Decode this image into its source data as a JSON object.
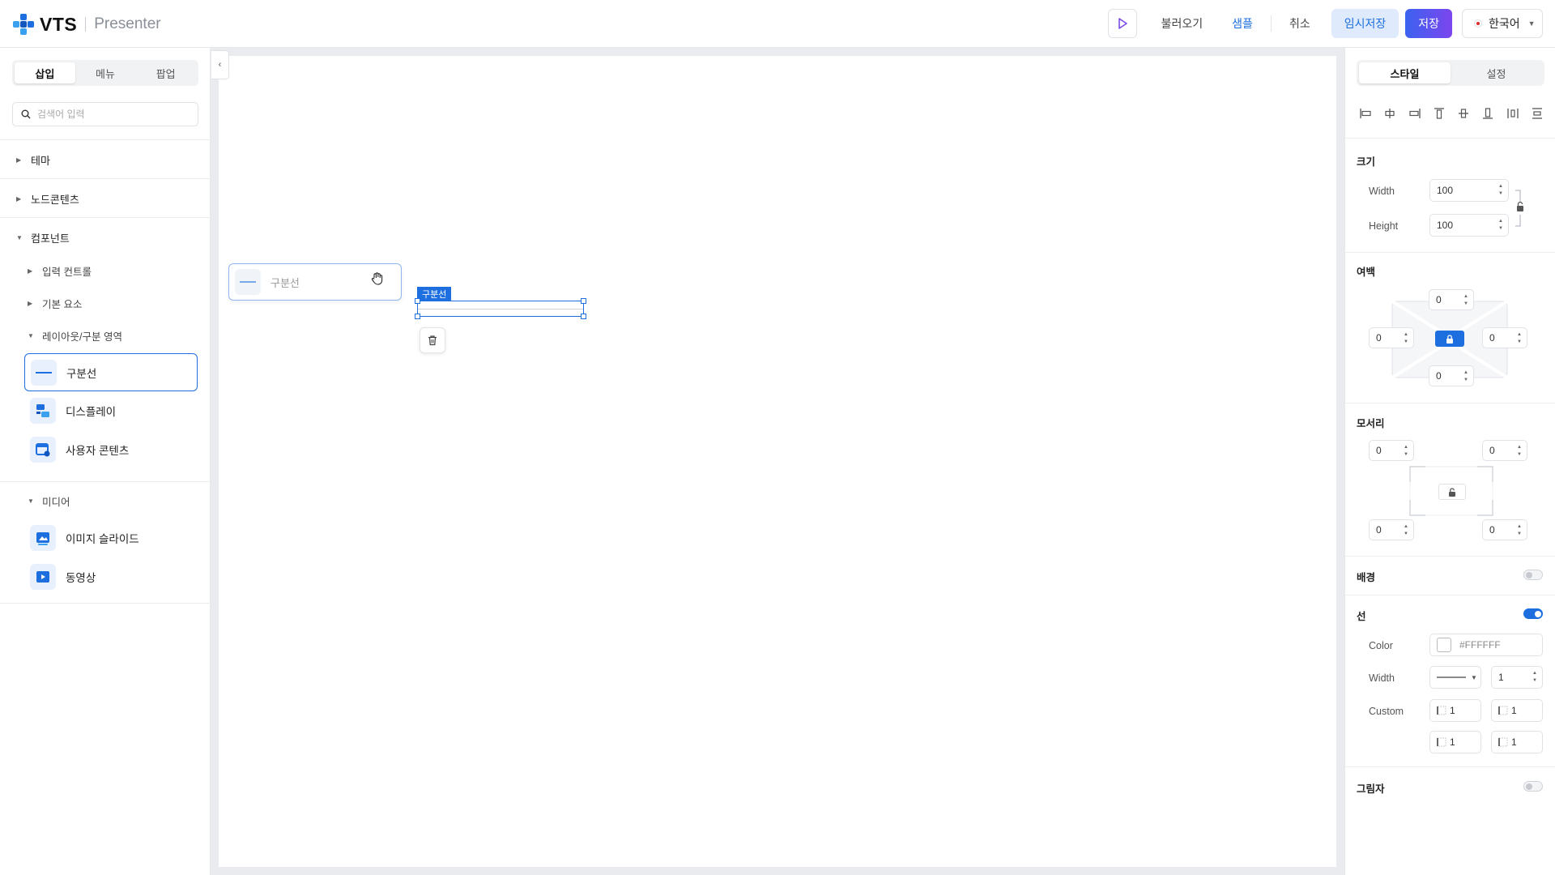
{
  "header": {
    "logo_text": "VTS",
    "app_name": "Presenter",
    "buttons": {
      "load": "불러오기",
      "sample": "샘플",
      "cancel": "취소",
      "temp_save": "임시저장",
      "save": "저장"
    },
    "language": "한국어"
  },
  "sidebar": {
    "tabs": [
      "삽입",
      "메뉴",
      "팝업"
    ],
    "search_placeholder": "검색어 입력",
    "sections": {
      "theme": "테마",
      "node_contents": "노드콘텐츠",
      "components": "컴포넌트",
      "input_control": "입력 컨트롤",
      "basic_elements": "기본 요소",
      "layout_divider": "레이아웃/구분 영역",
      "media": "미디어"
    },
    "layout_items": [
      "구분선",
      "디스플레이",
      "사용자 콘텐츠"
    ],
    "media_items": [
      "이미지 슬라이드",
      "동영상"
    ]
  },
  "canvas": {
    "drag_chip_label": "구분선",
    "selection_label": "구분선"
  },
  "right_panel": {
    "tabs": [
      "스타일",
      "설정"
    ],
    "size": {
      "title": "크기",
      "width_label": "Width",
      "width": "100",
      "height_label": "Height",
      "height": "100"
    },
    "margin": {
      "title": "여백",
      "top": "0",
      "left": "0",
      "right": "0",
      "bottom": "0"
    },
    "corner": {
      "title": "모서리",
      "top_left": "0",
      "top_right": "0",
      "bottom_left": "0",
      "bottom_right": "0"
    },
    "background": {
      "title": "배경",
      "enabled": false
    },
    "line": {
      "title": "선",
      "enabled": true,
      "color_label": "Color",
      "color": "#FFFFFF",
      "width_label": "Width",
      "width": "1",
      "custom_label": "Custom",
      "custom": [
        "1",
        "1",
        "1",
        "1"
      ]
    },
    "shadow": {
      "title": "그림자",
      "enabled": false
    }
  },
  "colors": {
    "accent": "#1d6fe0",
    "save_gradient_start": "#3b63f0",
    "save_gradient_end": "#7c45ee"
  }
}
